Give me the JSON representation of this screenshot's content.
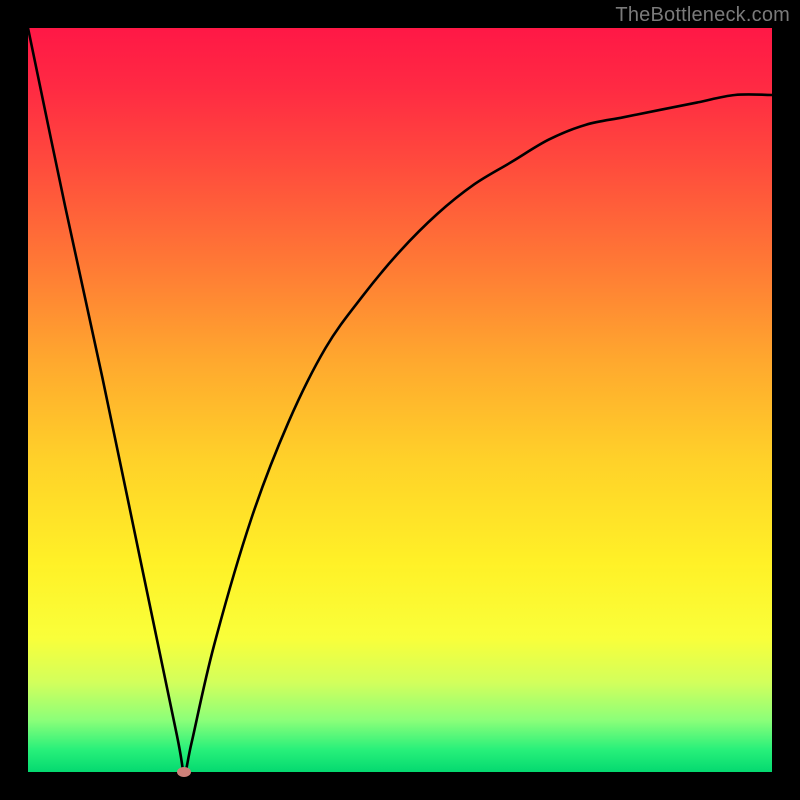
{
  "attribution": "TheBottleneck.com",
  "colors": {
    "background": "#000000",
    "gradient_top": "#ff1846",
    "gradient_bottom": "#04d970",
    "curve": "#000000",
    "marker": "#cd8079"
  },
  "chart_data": {
    "type": "line",
    "title": "",
    "xlabel": "",
    "ylabel": "",
    "xlim": [
      0,
      100
    ],
    "ylim": [
      0,
      100
    ],
    "x": [
      0,
      5,
      10,
      15,
      20,
      21,
      22,
      25,
      30,
      35,
      40,
      45,
      50,
      55,
      60,
      65,
      70,
      75,
      80,
      85,
      90,
      95,
      100
    ],
    "values": [
      100,
      76,
      53,
      29,
      5,
      0,
      4,
      17,
      34,
      47,
      57,
      64,
      70,
      75,
      79,
      82,
      85,
      87,
      88,
      89,
      90,
      91,
      91
    ],
    "marker": {
      "x": 21,
      "y": 0
    },
    "grid": false,
    "legend": false
  }
}
